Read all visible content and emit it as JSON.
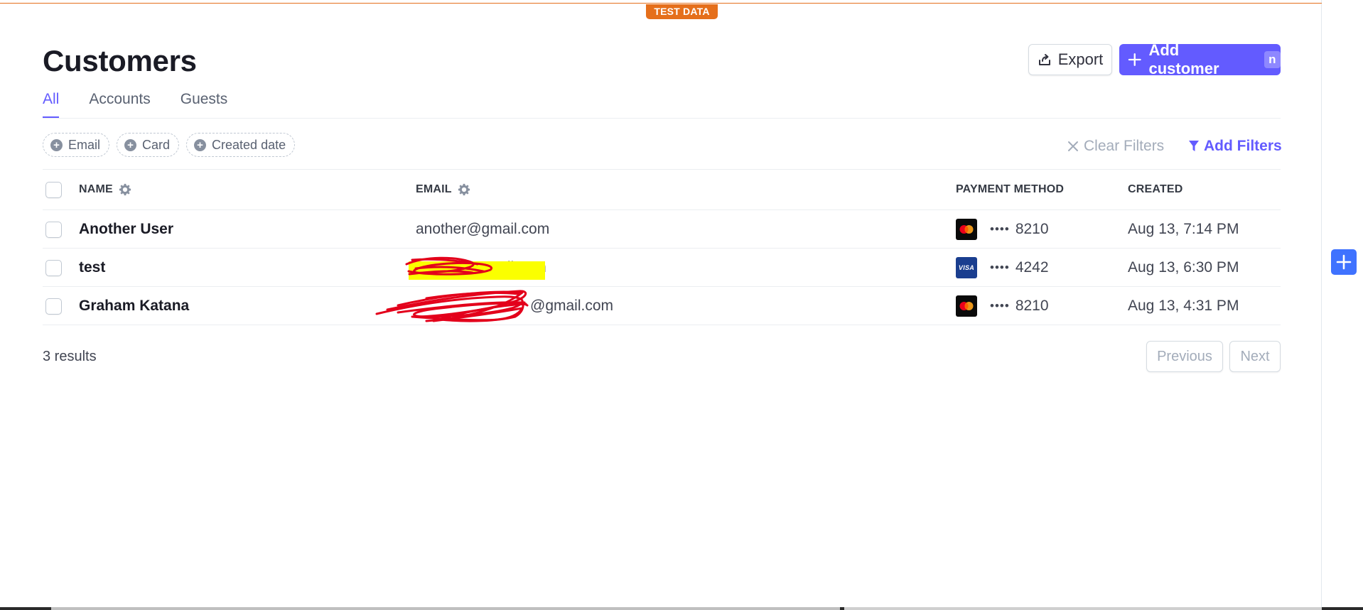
{
  "banner": {
    "label": "TEST DATA",
    "color": "#e56f1b"
  },
  "header": {
    "title": "Customers",
    "export_label": "Export",
    "add_label": "Add customer",
    "add_shortcut": "n",
    "accent": "#635bff"
  },
  "tabs": [
    {
      "label": "All",
      "active": true
    },
    {
      "label": "Accounts",
      "active": false
    },
    {
      "label": "Guests",
      "active": false
    }
  ],
  "filters": {
    "chips": [
      {
        "label": "Email",
        "icon": "plus-circle-icon"
      },
      {
        "label": "Card",
        "icon": "plus-circle-icon"
      },
      {
        "label": "Created date",
        "icon": "plus-circle-icon"
      }
    ],
    "clear_label": "Clear Filters",
    "add_label": "Add Filters"
  },
  "table": {
    "columns": {
      "name": "NAME",
      "email": "EMAIL",
      "payment": "PAYMENT METHOD",
      "created": "CREATED"
    },
    "rows": [
      {
        "name": "Another User",
        "email": "another@gmail.com",
        "brand": "mastercard",
        "dots": "••••",
        "last4": "8210",
        "created": "Aug 13, 7:14 PM"
      },
      {
        "name": "test",
        "email": "gmail.com",
        "brand": "visa",
        "brand_label": "VISA",
        "dots": "••••",
        "last4": "4242",
        "created": "Aug 13, 6:30 PM"
      },
      {
        "name": "Graham Katana",
        "email": "@gmail.com",
        "brand": "mastercard",
        "dots": "••••",
        "last4": "8210",
        "created": "Aug 13, 4:31 PM"
      }
    ]
  },
  "footer": {
    "results": "3 results",
    "prev_label": "Previous",
    "next_label": "Next"
  }
}
